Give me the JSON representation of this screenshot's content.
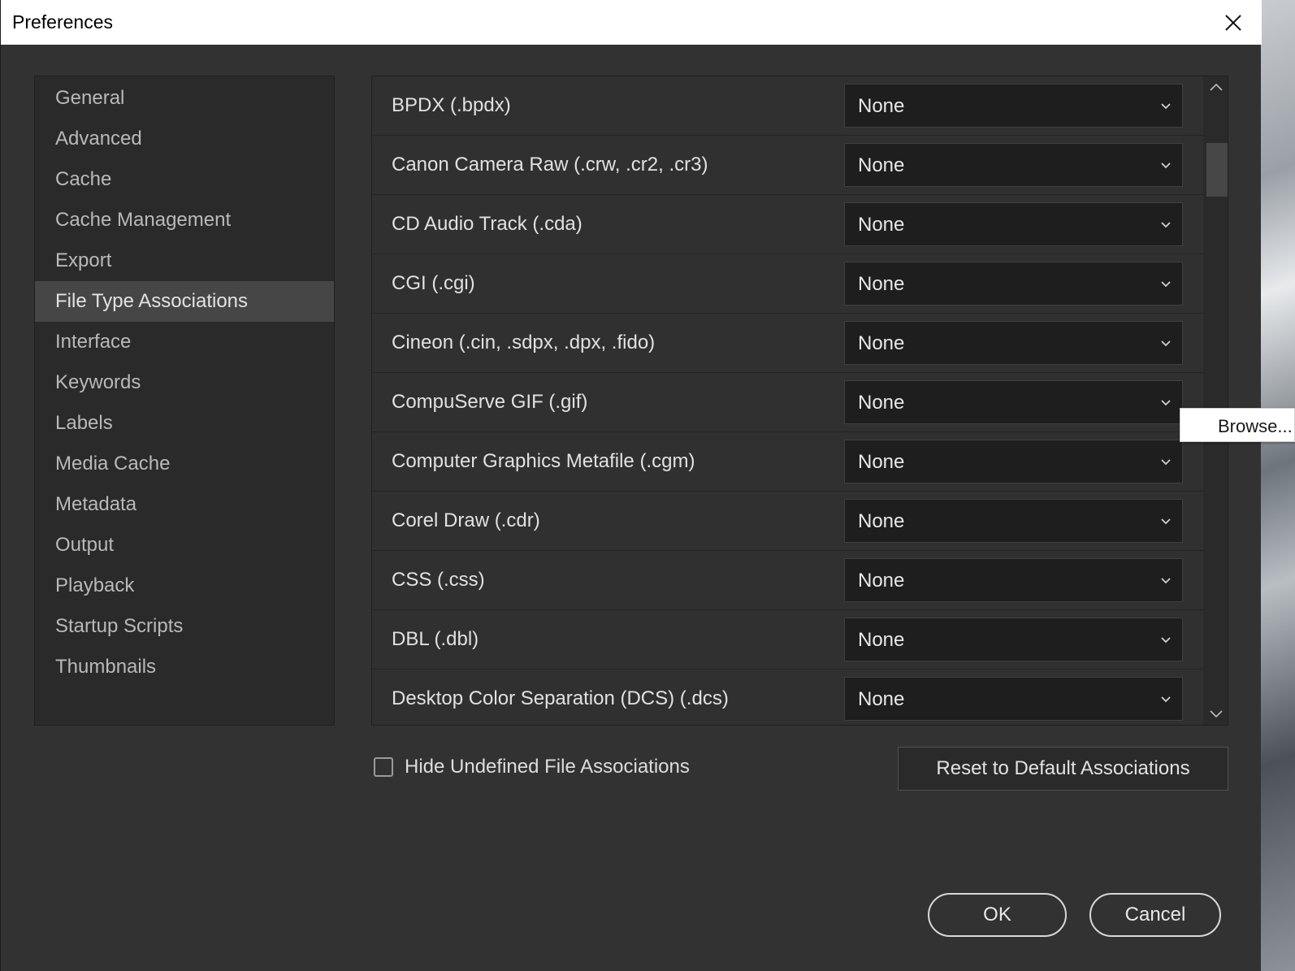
{
  "window": {
    "title": "Preferences"
  },
  "sidebar": {
    "items": [
      {
        "label": "General"
      },
      {
        "label": "Advanced"
      },
      {
        "label": "Cache"
      },
      {
        "label": "Cache Management"
      },
      {
        "label": "Export"
      },
      {
        "label": "File Type Associations",
        "active": true
      },
      {
        "label": "Interface"
      },
      {
        "label": "Keywords"
      },
      {
        "label": "Labels"
      },
      {
        "label": "Media Cache"
      },
      {
        "label": "Metadata"
      },
      {
        "label": "Output"
      },
      {
        "label": "Playback"
      },
      {
        "label": "Startup Scripts"
      },
      {
        "label": "Thumbnails"
      }
    ]
  },
  "associations": [
    {
      "type": "BPDX (.bpdx)",
      "app": "None"
    },
    {
      "type": "Canon Camera Raw (.crw, .cr2, .cr3)",
      "app": "None"
    },
    {
      "type": "CD Audio Track (.cda)",
      "app": "None"
    },
    {
      "type": "CGI (.cgi)",
      "app": "None"
    },
    {
      "type": "Cineon (.cin, .sdpx, .dpx, .fido)",
      "app": "None"
    },
    {
      "type": "CompuServe GIF (.gif)",
      "app": "None"
    },
    {
      "type": "Computer Graphics Metafile (.cgm)",
      "app": "None"
    },
    {
      "type": "Corel Draw (.cdr)",
      "app": "None"
    },
    {
      "type": "CSS (.css)",
      "app": "None"
    },
    {
      "type": "DBL (.dbl)",
      "app": "None"
    },
    {
      "type": "Desktop Color Separation (DCS) (.dcs)",
      "app": "None"
    }
  ],
  "dropdown_popup": {
    "item": "Browse..."
  },
  "options": {
    "hide_undefined_label": "Hide Undefined File Associations",
    "hide_undefined_checked": false,
    "reset_label": "Reset to Default Associations"
  },
  "footer": {
    "ok_label": "OK",
    "cancel_label": "Cancel"
  },
  "icons": {
    "close": "close-icon",
    "chevron": "chevron-down-icon",
    "scroll_up": "chevron-up-icon",
    "scroll_down": "chevron-down-icon"
  }
}
